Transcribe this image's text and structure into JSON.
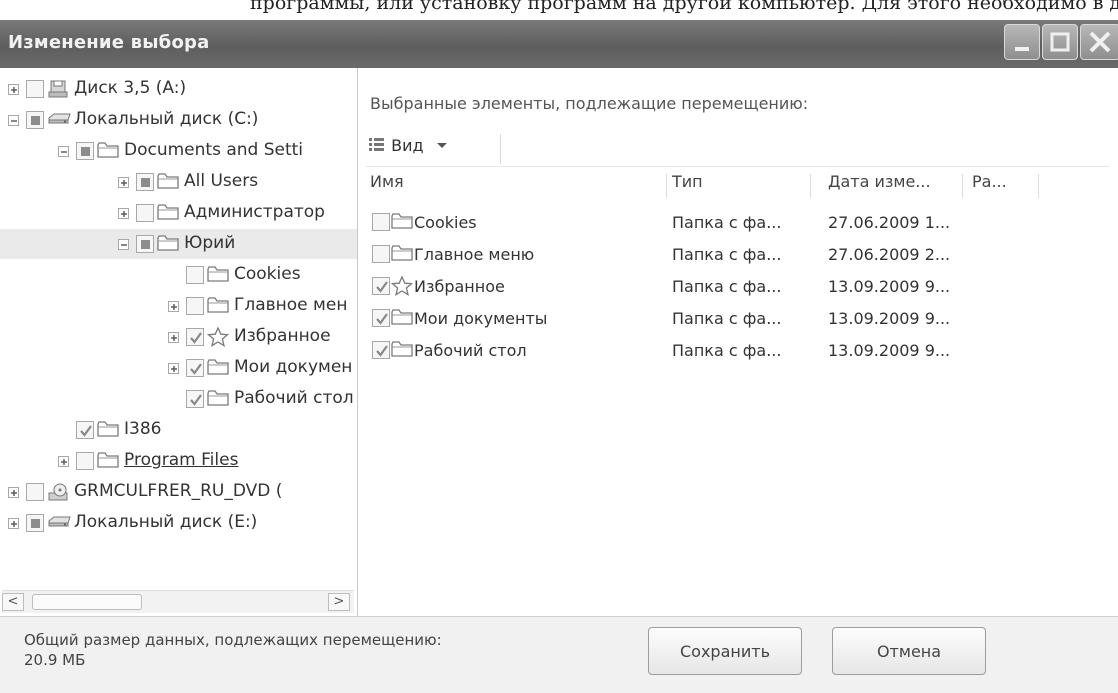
{
  "top_strip_text": "программы, или установку программ на другой компьютер. Для этого необходимо в данном окне…",
  "window": {
    "title": "Изменение выбора",
    "controls": {
      "minimize": "minimize",
      "maximize": "maximize",
      "close": "close"
    }
  },
  "tree": {
    "items": [
      {
        "label": "Диск 3,5 (A:)",
        "icon": "floppy-drive-icon",
        "level": 0,
        "expander": "plus",
        "check": "unchecked"
      },
      {
        "label": "Локальный диск (C:)",
        "icon": "hard-drive-icon",
        "level": 0,
        "expander": "minus",
        "check": "partial"
      },
      {
        "label": "Documents and Setti",
        "icon": "folder-icon",
        "level": 1,
        "expander": "minus",
        "check": "partial"
      },
      {
        "label": "All Users",
        "icon": "folder-icon",
        "level": 2,
        "expander": "plus",
        "check": "partial"
      },
      {
        "label": "Администратор",
        "icon": "folder-icon",
        "level": 2,
        "expander": "plus",
        "check": "unchecked"
      },
      {
        "label": "Юрий",
        "icon": "folder-icon",
        "level": 2,
        "expander": "minus",
        "check": "partial",
        "selected": true
      },
      {
        "label": "Cookies",
        "icon": "folder-icon",
        "level": 3,
        "expander": "none",
        "check": "unchecked"
      },
      {
        "label": "Главное мен",
        "icon": "folder-icon",
        "level": 3,
        "expander": "plus",
        "check": "unchecked"
      },
      {
        "label": "Избранное",
        "icon": "star-icon",
        "level": 3,
        "expander": "plus",
        "check": "checked"
      },
      {
        "label": "Мои докумен",
        "icon": "folder-icon",
        "level": 3,
        "expander": "plus",
        "check": "checked"
      },
      {
        "label": "Рабочий стол",
        "icon": "folder-icon",
        "level": 3,
        "expander": "none",
        "check": "checked"
      },
      {
        "label": "I386",
        "icon": "folder-icon",
        "level": 1,
        "expander": "none",
        "check": "checked"
      },
      {
        "label": "Program Files",
        "icon": "folder-icon",
        "level": 1,
        "expander": "plus",
        "check": "unchecked",
        "link": true
      },
      {
        "label": "GRMCULFRER_RU_DVD (",
        "icon": "dvd-drive-icon",
        "level": 0,
        "expander": "plus",
        "check": "unchecked"
      },
      {
        "label": "Локальный диск (E:)",
        "icon": "hard-drive-icon",
        "level": 0,
        "expander": "plus",
        "check": "partial"
      }
    ]
  },
  "right": {
    "info": "Выбранные элементы, подлежащие перемещению:",
    "view_label": "Вид",
    "columns": [
      "Имя",
      "Тип",
      "Дата изме...",
      "Ра..."
    ],
    "rows": [
      {
        "name": "Cookies",
        "type": "Папка с фа...",
        "date": "27.06.2009 1...",
        "icon": "folder-icon",
        "check": "unchecked"
      },
      {
        "name": "Главное меню",
        "type": "Папка с фа...",
        "date": "27.06.2009 2...",
        "icon": "folder-icon",
        "check": "unchecked"
      },
      {
        "name": "Избранное",
        "type": "Папка с фа...",
        "date": "13.09.2009 9...",
        "icon": "star-icon",
        "check": "checked"
      },
      {
        "name": "Мои документы",
        "type": "Папка с фа...",
        "date": "13.09.2009 9...",
        "icon": "folder-icon",
        "check": "checked"
      },
      {
        "name": "Рабочий стол",
        "type": "Папка с фа...",
        "date": "13.09.2009 9...",
        "icon": "folder-icon",
        "check": "checked"
      }
    ]
  },
  "bottom": {
    "summary_label": "Общий размер данных, подлежащих перемещению:",
    "summary_value": "20.9 МБ",
    "save_label": "Сохранить",
    "cancel_label": "Отмена"
  }
}
